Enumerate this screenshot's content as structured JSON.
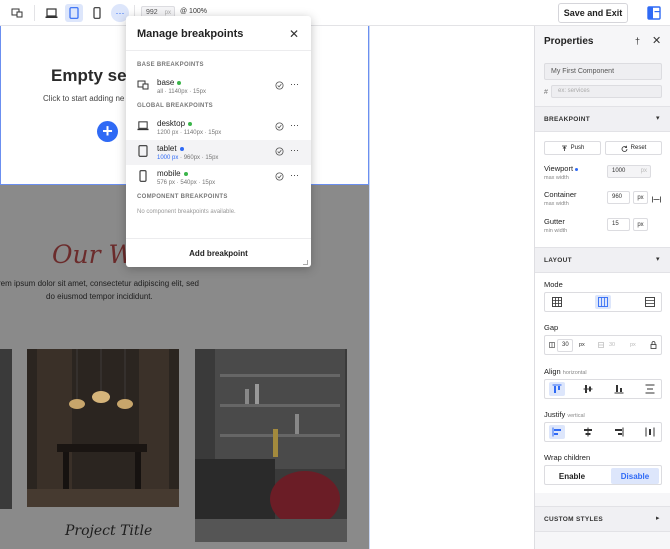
{
  "toolbar": {
    "viewport_value": "992",
    "viewport_unit": "px",
    "zoom": "@ 100%",
    "save_exit_label": "Save and Exit",
    "more_glyph": "⋯"
  },
  "canvas": {
    "empty_title": "Empty sec",
    "empty_subtitle": "Click to start adding ne",
    "heading": "Our W",
    "body_line1": "rem ipsum dolor sit amet, consectetur adipiscing elit, sed",
    "body_line2": "do eiusmod tempor incididunt.",
    "project_title": "Project Title"
  },
  "breakpoints_popover": {
    "title": "Manage breakpoints",
    "close_glyph": "✕",
    "base_section_label": "BASE BREAKPOINTS",
    "global_section_label": "GLOBAL BREAKPOINTS",
    "component_section_label": "COMPONENT BREAKPOINTS",
    "no_component_text": "No component breakpoints available.",
    "add_label": "Add breakpoint",
    "more_glyph": "⋯",
    "base": {
      "name": "base",
      "dot_color": "#3ab54a",
      "meta": [
        "all",
        "1140px",
        "15px"
      ]
    },
    "global": [
      {
        "name": "desktop",
        "dot_color": "#3ab54a",
        "meta": [
          "1200 px",
          "1140px",
          "15px"
        ],
        "highlight": false,
        "icon": "laptop-icon"
      },
      {
        "name": "tablet",
        "dot_color": "#2f6af5",
        "meta": [
          "1000 px",
          "960px",
          "15px"
        ],
        "highlight": true,
        "icon": "tablet-icon"
      },
      {
        "name": "mobile",
        "dot_color": "#3ab54a",
        "meta": [
          "576 px",
          "540px",
          "15px"
        ],
        "highlight": false,
        "icon": "mobile-icon"
      }
    ]
  },
  "properties": {
    "title": "Properties",
    "close_glyph": "✕",
    "pin_glyph": "†",
    "component_name": "My First Component",
    "hash": "#",
    "id_placeholder": "ex: services",
    "breakpoint_section": "BREAKPOINT",
    "push_label": "Push",
    "reset_label": "Reset",
    "viewport_label": "Viewport",
    "viewport_sub": "max width",
    "viewport_value": "1000",
    "viewport_unit": "px",
    "container_label": "Container",
    "container_sub": "max width",
    "container_value": "960",
    "container_unit": "px",
    "gutter_label": "Gutter",
    "gutter_sub": "min width",
    "gutter_value": "15",
    "gutter_unit": "px",
    "layout_section": "LAYOUT",
    "mode_label": "Mode",
    "gap_label": "Gap",
    "gap_col_value": "30",
    "gap_col_unit": "px",
    "gap_row_value": "30",
    "gap_row_unit": "px",
    "align_label": "Align",
    "align_sub": "horizontal",
    "justify_label": "Justify",
    "justify_sub": "vertical",
    "wrap_label": "Wrap children",
    "enable_label": "Enable",
    "disable_label": "Disable",
    "custom_styles_section": "CUSTOM STYLES",
    "chevron_down": "▾",
    "chevron_right": "▸"
  },
  "colors": {
    "accent": "#2f6af5",
    "accent_light": "#dde6fb",
    "heading_red": "#6b2b2b"
  }
}
